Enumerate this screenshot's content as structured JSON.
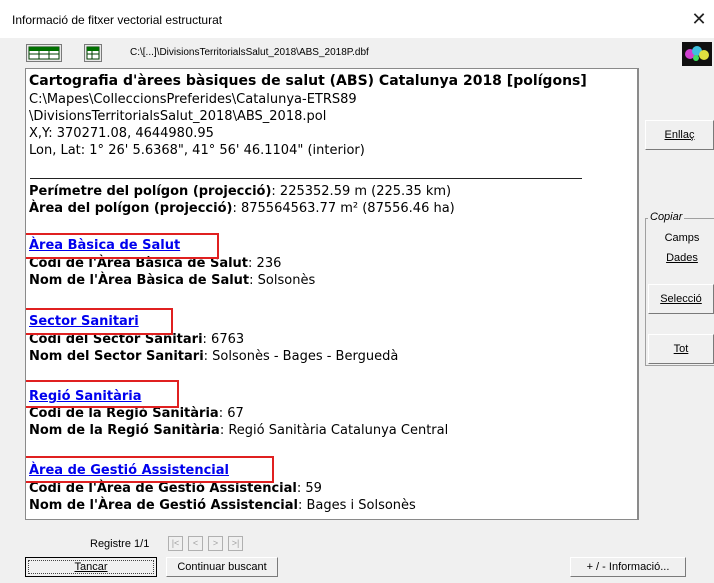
{
  "window": {
    "title": "Informació de fitxer vectorial estructurat",
    "close_glyph": "✕"
  },
  "toolbar": {
    "file_path": "C:\\[...]\\DivisionsTerritorialsSalut_2018\\ABS_2018P.dbf",
    "table_icon": "table-icon",
    "save_icon": "save-table-icon",
    "logo": "miramon-logo"
  },
  "info": {
    "heading": "Cartografia d'àrees bàsiques de salut (ABS) Catalunya 2018 [polígons]",
    "path_line1": "C:\\Mapes\\ColleccionsPreferides\\Catalunya-ETRS89",
    "path_line2": "\\DivisionsTerritorialsSalut_2018\\ABS_2018.pol",
    "xy": "X,Y: 370271.08, 4644980.95",
    "lonlat": "Lon, Lat: 1° 26' 5.6368\", 41° 56' 46.1104\" (interior)",
    "perimeter_label": "Perímetre del polígon (projecció)",
    "perimeter_value": ": 225352.59 m (225.35 km)",
    "area_label": "Àrea del polígon (projecció)",
    "area_value": ": 875564563.77 m² (87556.46 ha)",
    "sections": [
      {
        "link": "Àrea Bàsica de Salut",
        "code_label": "Codi de l'Àrea Bàsica de Salut",
        "code_value": ": 236",
        "name_label": "Nom de l'Àrea Bàsica de Salut",
        "name_value": ": Solsonès"
      },
      {
        "link": "Sector Sanitari",
        "code_label": "Codi del Sector Sanitari",
        "code_value": ": 6763",
        "name_label": "Nom del Sector Sanitari",
        "name_value": ": Solsonès - Bages - Berguedà"
      },
      {
        "link": "Regió Sanitària",
        "code_label": "Codi de la Regió Sanitària",
        "code_value": ": 67",
        "name_label": "Nom de la Regió Sanitària",
        "name_value": ": Regió Sanitària Catalunya Central"
      },
      {
        "link": "Àrea de Gestió Assistencial",
        "code_label": "Codi de l'Àrea de Gestió Assistencial",
        "code_value": ": 59",
        "name_label": "Nom de l'Àrea de Gestió Assistencial",
        "name_value": ": Bages i Solsonès"
      }
    ]
  },
  "side": {
    "link_btn": "Enllaç",
    "copy_group": "Copiar",
    "fields_btn": "Camps",
    "data_btn": "Dades",
    "selection_btn": "Selecció",
    "all_btn": "Tot"
  },
  "footer": {
    "record": "Registre 1/1",
    "nav": [
      "|<",
      "<",
      ">",
      ">|"
    ],
    "close_btn": "Tancar",
    "continue_btn": "Continuar buscant",
    "more_info_btn": "+ / - Informació..."
  },
  "colors": {
    "link": "#0000ee",
    "highlight": "#e02020",
    "panel_bg": "#ffffff",
    "window_bg": "#f0f0f0"
  }
}
